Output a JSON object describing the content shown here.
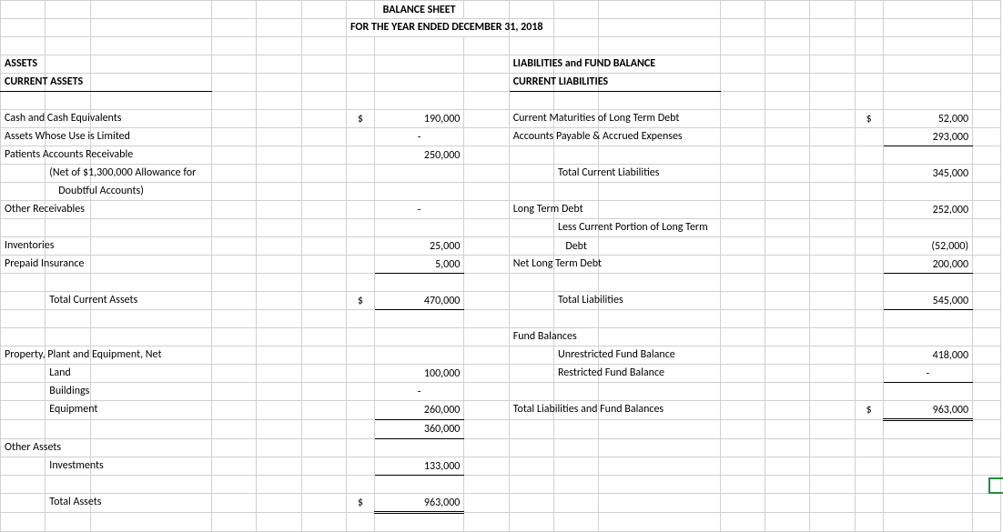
{
  "title": "BALANCE SHEET",
  "subtitle": "FOR THE YEAR ENDED DECEMBER 31, 2018",
  "left": {
    "h1": "ASSETS",
    "h2": "CURRENT ASSETS",
    "l_cash": "Cash and Cash Equivalents",
    "l_limited": "Assets Whose Use is Limited",
    "l_par": "Patients Accounts Receivable",
    "l_par_note1": "(Net of $1,300,000 Allowance for",
    "l_par_note2": "Doubtful Accounts)",
    "l_other_recv": "Other Receivables",
    "l_inv": "Inventories",
    "l_prepaid": "Prepaid Insurance",
    "l_tca": "Total Current Assets",
    "l_ppe": "Property, Plant and Equipment, Net",
    "l_land": "Land",
    "l_bldg": "Buildings",
    "l_equip": "Equipment",
    "l_other_assets": "Other Assets",
    "l_invest": "Investments",
    "l_ta": "Total Assets",
    "cur": "$",
    "v_cash": "190,000",
    "v_limited": "-",
    "v_par": "250,000",
    "v_other_recv": "-",
    "v_inv": "25,000",
    "v_prepaid": "5,000",
    "v_tca": "470,000",
    "v_land": "100,000",
    "v_bldg": "-",
    "v_equip": "260,000",
    "v_ppe_total": "360,000",
    "v_invest": "133,000",
    "v_ta": "963,000"
  },
  "right": {
    "h1": "LIABILITIES and FUND BALANCE",
    "h2": "CURRENT LIABILITIES",
    "l_cmlt": "Current Maturities of Long Term Debt",
    "l_ap": "Accounts Payable & Accrued Expenses",
    "l_tcl": "Total Current Liabilities",
    "l_ltd": "Long Term Debt",
    "l_less": "Less Current Portion of Long Term",
    "l_less2": "Debt",
    "l_nltd": "Net Long Term Debt",
    "l_tl": "Total Liabilities",
    "l_fb": "Fund Balances",
    "l_ufb": "Unrestricted Fund Balance",
    "l_rfb": "Restricted Fund Balance",
    "l_tlfb": "Total Liabilities and Fund Balances",
    "cur": "$",
    "v_cmlt": "52,000",
    "v_ap": "293,000",
    "v_tcl": "345,000",
    "v_ltd": "252,000",
    "v_less": "(52,000)",
    "v_nltd": "200,000",
    "v_tl": "545,000",
    "v_ufb": "418,000",
    "v_rfb": "-",
    "v_tlfb": "963,000"
  }
}
